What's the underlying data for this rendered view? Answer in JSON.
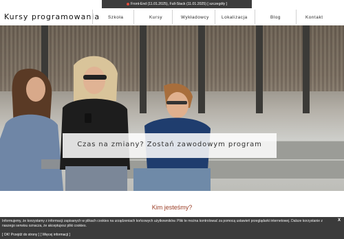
{
  "header": {
    "brand": "Kursy programowania",
    "announcement": "Front-End (11.01.2025), Full-Stack (11.01.2025) [ szczegóły ]"
  },
  "nav": {
    "items": [
      "Szkoła",
      "Kursy",
      "Wykładowcy",
      "Lokalizacja",
      "Blog",
      "Kontakt"
    ]
  },
  "hero": {
    "tagline": "Czas na zmiany? Zostań zawodowym program"
  },
  "main": {
    "section_heading": "Kim jesteśmy?"
  },
  "cookie": {
    "text": "Informujemy, że korzystamy z informacji zapisanych w plikach cookies na urządzeniach końcowych użytkowników. Pliki te można kontrolować za pomocą ustawień przeglądarki internetowej. Dalsze korzystanie z naszego serwisu oznacza, że akceptujesz pliki cookies.",
    "close": "X",
    "accept": "[ OK! Przejdź do strony ]",
    "more": "[ Więcej informacji ]"
  },
  "colors": {
    "announce_bg": "#3c3c3c",
    "heading": "#9b3d25",
    "cookie_bg": "#3b3b3b"
  }
}
